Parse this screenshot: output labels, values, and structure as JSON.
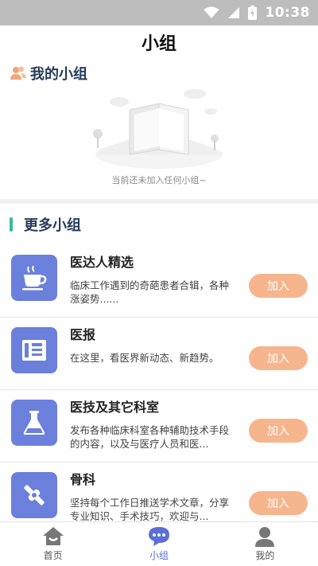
{
  "status_bar": {
    "time": "10:38"
  },
  "header": {
    "title": "小组"
  },
  "my_groups": {
    "title": "我的小组",
    "empty_text": "当前还未加入任何小组~"
  },
  "more_groups": {
    "title": "更多小组",
    "items": [
      {
        "name": "医达人精选",
        "desc": "临床工作遇到的奇葩患者合辑，各种涨姿势......",
        "icon": "coffee-cup-icon",
        "button": "加入"
      },
      {
        "name": "医报",
        "desc": "在这里，看医界新动态、新趋势。",
        "icon": "newspaper-icon",
        "button": "加入"
      },
      {
        "name": "医技及其它科室",
        "desc": "发布各种临床科室各种辅助技术手段的内容，以及与医疗人员和医...",
        "icon": "flask-icon",
        "button": "加入"
      },
      {
        "name": "骨科",
        "desc": "坚持每个工作日推送学术文章，分享专业知识、手术技巧，欢迎与...",
        "icon": "bone-icon",
        "button": "加入"
      }
    ]
  },
  "bottom_nav": {
    "items": [
      {
        "label": "首页",
        "icon": "home-icon"
      },
      {
        "label": "小组",
        "icon": "chat-bubble-icon",
        "active": true
      },
      {
        "label": "我的",
        "icon": "person-icon"
      }
    ]
  },
  "colors": {
    "accent": "#5b6fd4",
    "group_icon_bg": "#6b7fdc",
    "join_button": "#f6b58d",
    "section_bar": "#3bb8a0",
    "section_title": "#263c5b"
  }
}
